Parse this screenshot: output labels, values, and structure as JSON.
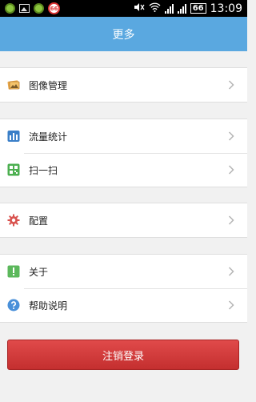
{
  "status_bar": {
    "time": "13:09",
    "battery": "66",
    "notification_badge": "66"
  },
  "header": {
    "title": "更多"
  },
  "groups": [
    {
      "items": [
        {
          "label": "图像管理",
          "icon": "image-manage-icon"
        }
      ]
    },
    {
      "items": [
        {
          "label": "流量统计",
          "icon": "traffic-stats-icon"
        },
        {
          "label": "扫一扫",
          "icon": "qr-scan-icon"
        }
      ]
    },
    {
      "items": [
        {
          "label": "配置",
          "icon": "gear-icon"
        }
      ]
    },
    {
      "items": [
        {
          "label": "关于",
          "icon": "about-icon"
        },
        {
          "label": "帮助说明",
          "icon": "help-icon"
        }
      ]
    }
  ],
  "logout": {
    "label": "注销登录"
  },
  "colors": {
    "header": "#5aa8e0",
    "logout": "#d03a3a"
  }
}
